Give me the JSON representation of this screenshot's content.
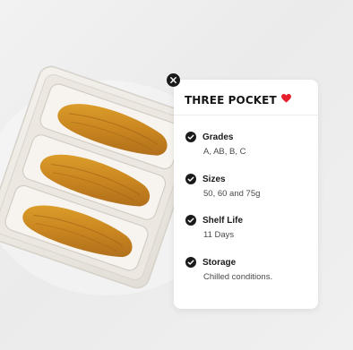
{
  "card": {
    "title": "THREE POCKET",
    "items": [
      {
        "label": "Grades",
        "value": "A, AB, B, C"
      },
      {
        "label": "Sizes",
        "value": "50, 60 and 75g"
      },
      {
        "label": "Shelf Life",
        "value": "11 Days"
      },
      {
        "label": "Storage",
        "value": "Chilled conditions."
      }
    ]
  },
  "icons": {
    "close": "close-icon",
    "heart": "heart-icon",
    "check": "check-circle-icon"
  },
  "colors": {
    "heart": "#e8202b",
    "icon_dark": "#1a1a1a",
    "card_bg": "#ffffff"
  }
}
